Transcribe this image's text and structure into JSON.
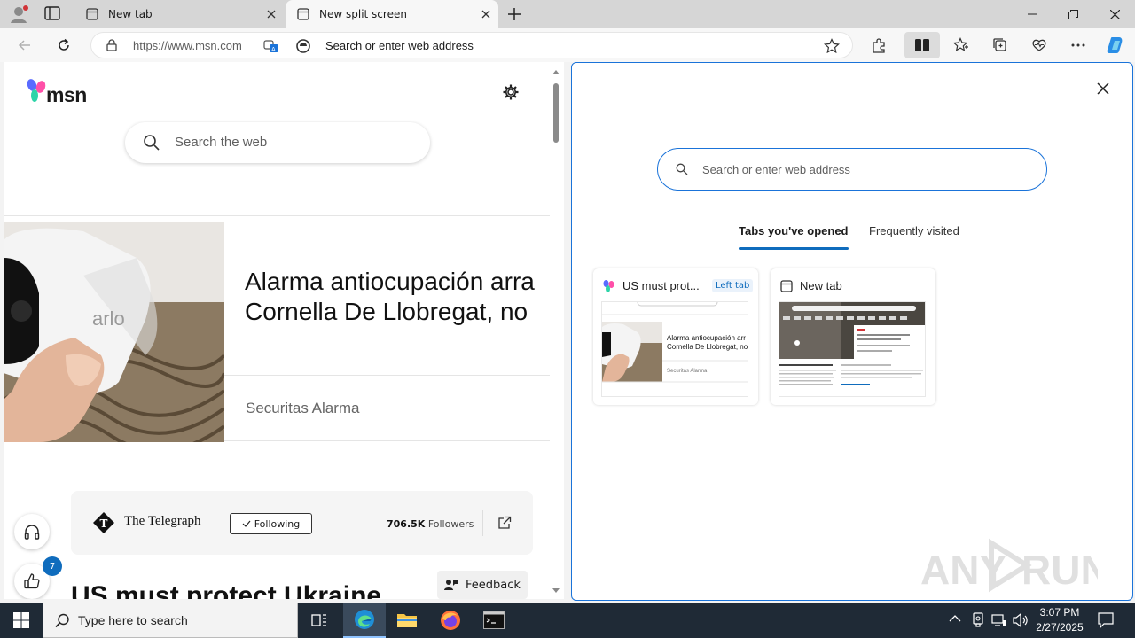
{
  "browser": {
    "tabs": [
      {
        "title": "New tab",
        "active": false
      },
      {
        "title": "New split screen",
        "active": true
      }
    ],
    "address": {
      "url": "https://www.msn.com",
      "placeholder": "Search or enter web address"
    }
  },
  "left_pane": {
    "logo": "msn",
    "search_placeholder": "Search the web",
    "ad": {
      "title_line1": "Alarma antiocupación arra",
      "title_line2": "Cornella De Llobregat, no",
      "source": "Securitas Alarma",
      "image_brand": "arlo"
    },
    "publisher": {
      "name": "The Telegraph",
      "follow_label": "Following",
      "followers_count": "706.5K",
      "followers_label": "Followers"
    },
    "feedback_label": "Feedback",
    "headline": "US must protect Ukraine",
    "like_badge": "7"
  },
  "right_pane": {
    "search_placeholder": "Search or enter web address",
    "tabs": [
      "Tabs you've opened",
      "Frequently visited"
    ],
    "tiles": [
      {
        "title": "US must prot...",
        "badge": "Left tab",
        "thumb_title1": "Alarma antiocupación arr",
        "thumb_title2": "Cornella De Llobregat, no",
        "thumb_source": "Securitas Alarma"
      },
      {
        "title": "New tab"
      }
    ]
  },
  "taskbar": {
    "search_placeholder": "Type here to search",
    "time": "3:07 PM",
    "date": "2/27/2025"
  },
  "watermark": "ANY RUN",
  "colors": {
    "accent": "#0f6cbd",
    "split_border": "#1a73d9",
    "taskbar": "#1f2a36"
  }
}
